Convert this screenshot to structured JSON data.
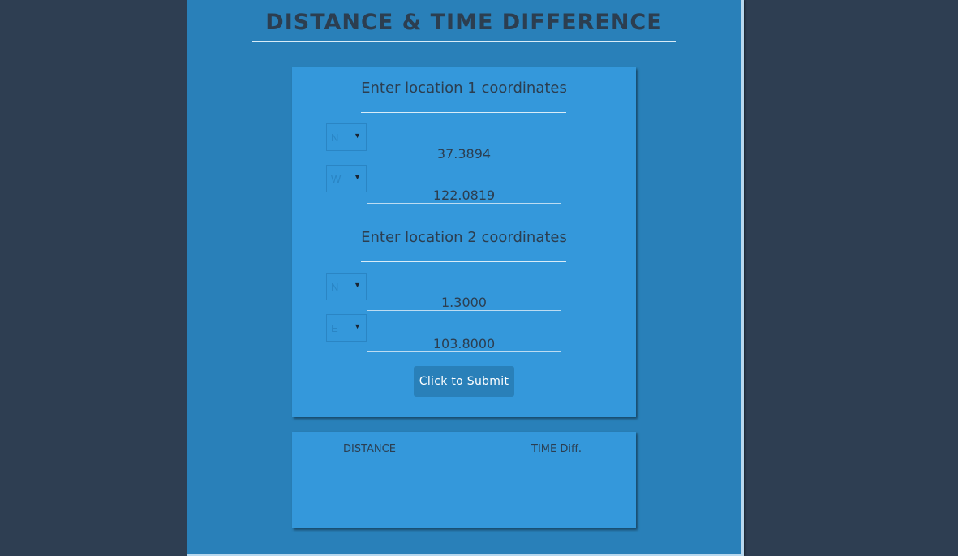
{
  "header": {
    "title": "DISTANCE & TIME DIFFERENCE"
  },
  "form": {
    "location1": {
      "heading": "Enter location 1 coordinates",
      "lat_dir": "N",
      "lat_value": "37.3894",
      "lon_dir": "W",
      "lon_value": "122.0819"
    },
    "location2": {
      "heading": "Enter location 2 coordinates",
      "lat_dir": "N",
      "lat_value": "1.3000",
      "lon_dir": "E",
      "lon_value": "103.8000"
    },
    "submit_label": "Click to Submit"
  },
  "results": {
    "distance_label": "DISTANCE",
    "time_label": "TIME Diff."
  },
  "colors": {
    "background": "#2e3e52",
    "panel": "#2980b9",
    "card": "#3498db",
    "text": "#2c3e50"
  }
}
